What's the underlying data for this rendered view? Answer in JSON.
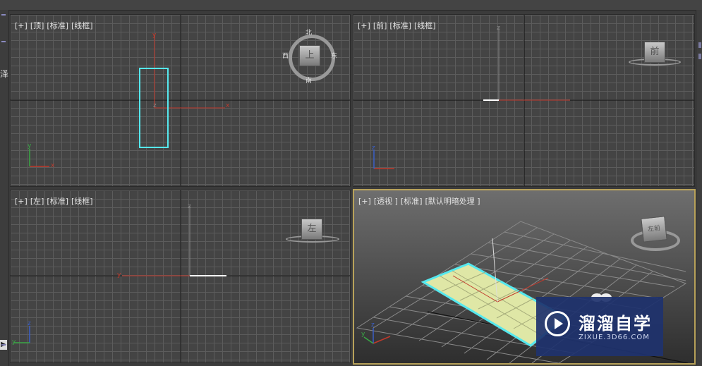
{
  "sidebar_left": {
    "glyph": "泽",
    "arrow": "▶"
  },
  "viewports": {
    "top": {
      "plus": "[+]",
      "view": "[顶]",
      "mode": "[标准]",
      "shading": "[线框]",
      "cube_face": "上",
      "compass": {
        "north": "北",
        "south": "南",
        "east": "东",
        "west": "西"
      }
    },
    "front": {
      "plus": "[+]",
      "view": "[前]",
      "mode": "[标准]",
      "shading": "[线框]",
      "cube_face": "前"
    },
    "left": {
      "plus": "[+]",
      "view": "[左]",
      "mode": "[标准]",
      "shading": "[线框]",
      "cube_face": "左"
    },
    "persp": {
      "plus": "[+]",
      "view": "[透视 ]",
      "mode": "[标准]",
      "shading": "[默认明暗处理 ]",
      "cube_face": "左前"
    }
  },
  "axes": {
    "x": "x",
    "y": "y",
    "z": "z"
  },
  "watermark": {
    "title": "溜溜自学",
    "url": "ZIXUE.3D66.COM"
  },
  "colors": {
    "selection": "#55e8ee",
    "plane_fill": "#dfe7a6",
    "x_axis": "#c0392b",
    "y_axis": "#39a845",
    "z_axis": "#3a5fc8",
    "active_border": "#b8a25a"
  }
}
